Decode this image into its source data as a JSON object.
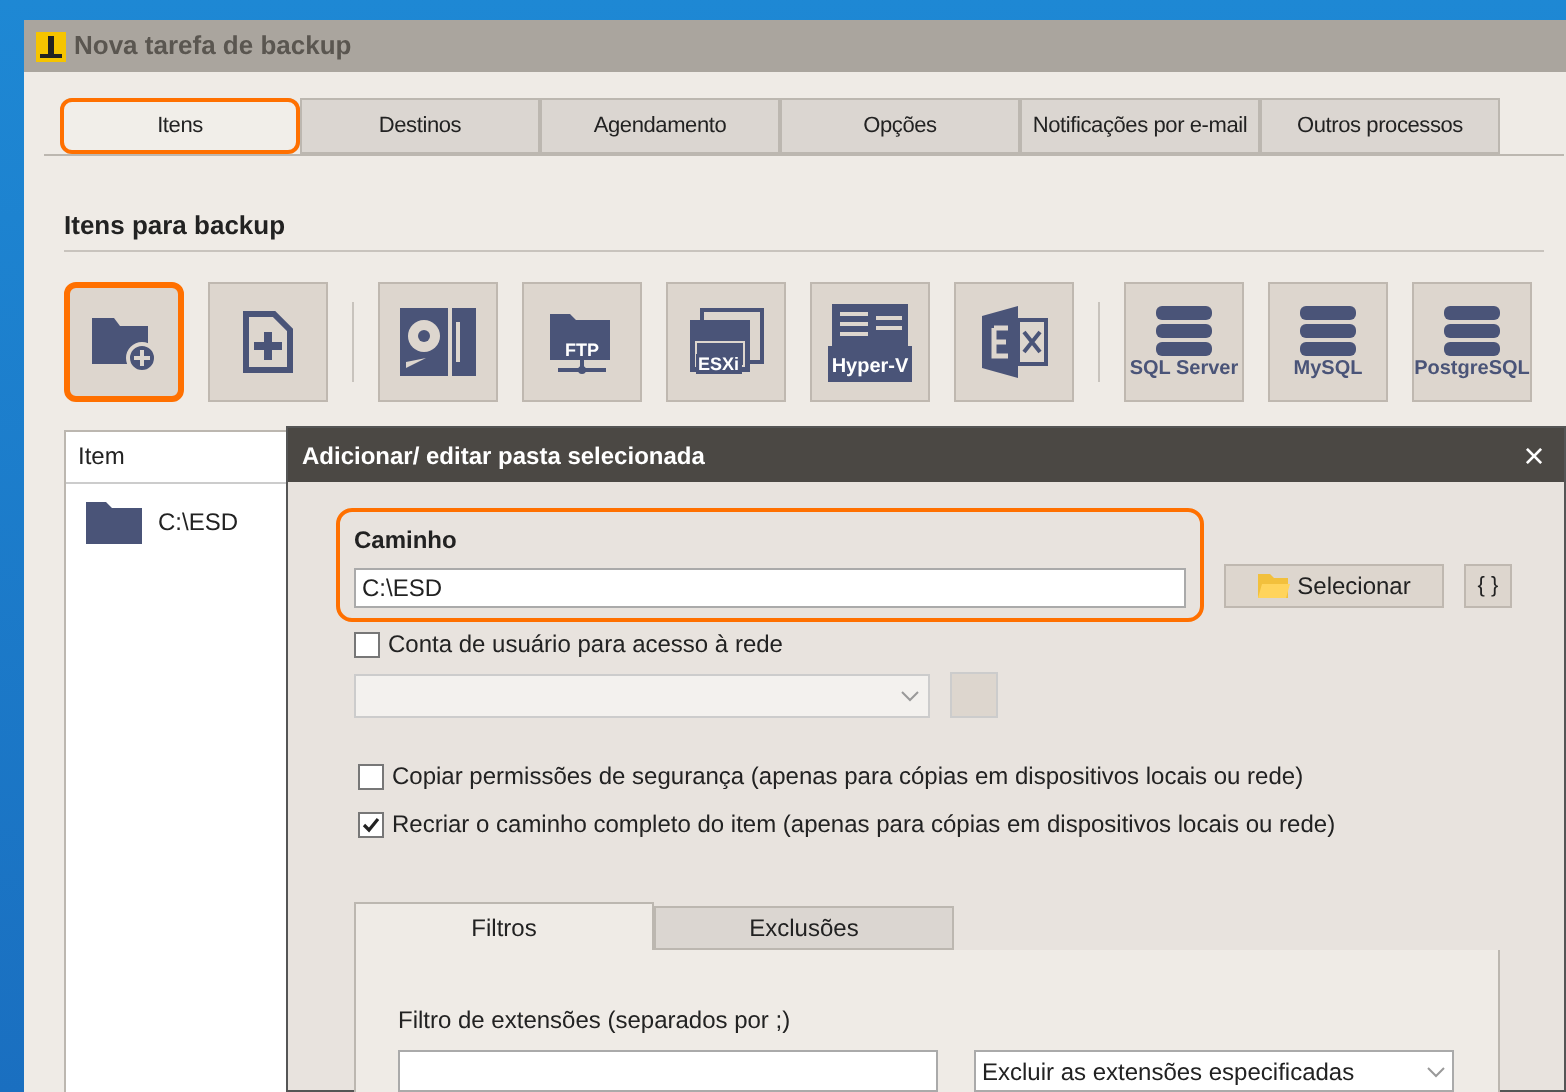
{
  "window": {
    "title": "Nova tarefa de backup"
  },
  "tabs": [
    {
      "label": "Itens",
      "selected": true,
      "highlighted": true
    },
    {
      "label": "Destinos",
      "selected": false,
      "highlighted": false
    },
    {
      "label": "Agendamento",
      "selected": false,
      "highlighted": false
    },
    {
      "label": "Opções",
      "selected": false,
      "highlighted": false
    },
    {
      "label": "Notificações por e-mail",
      "selected": false,
      "highlighted": false
    },
    {
      "label": "Outros processos",
      "selected": false,
      "highlighted": false
    }
  ],
  "section_title": "Itens para backup",
  "toolbar": [
    [
      {
        "kind": "folder-add",
        "highlighted": true
      },
      {
        "kind": "file-add",
        "highlighted": false
      }
    ],
    [
      {
        "kind": "disk",
        "highlighted": false
      },
      {
        "kind": "ftp",
        "label": "FTP",
        "highlighted": false
      },
      {
        "kind": "esxi",
        "label": "ESXi",
        "highlighted": false
      },
      {
        "kind": "hyperv",
        "label": "Hyper-V",
        "highlighted": false
      },
      {
        "kind": "exchange",
        "highlighted": false
      }
    ],
    [
      {
        "kind": "database",
        "label": "SQL Server",
        "highlighted": false
      },
      {
        "kind": "database",
        "label": "MySQL",
        "highlighted": false
      },
      {
        "kind": "database",
        "label": "PostgreSQL",
        "highlighted": false
      }
    ]
  ],
  "item_list": {
    "column": "Item",
    "rows": [
      {
        "name": "C:\\ESD"
      }
    ]
  },
  "dialog": {
    "title": "Adicionar/ editar pasta selecionada",
    "close": "×",
    "path": {
      "label": "Caminho",
      "value": "C:\\ESD",
      "highlighted": true
    },
    "select_button": "Selecionar",
    "vars_button": "{ }",
    "network_account": {
      "label": "Conta de usuário para acesso à rede",
      "checked": false
    },
    "options": [
      {
        "label": "Copiar permissões de segurança (apenas para cópias em dispositivos locais ou rede)",
        "checked": false
      },
      {
        "label": "Recriar o caminho completo do item (apenas para cópias em dispositivos locais ou rede)",
        "checked": true
      }
    ],
    "tabs": [
      {
        "label": "Filtros",
        "selected": true
      },
      {
        "label": "Exclusões",
        "selected": false
      }
    ],
    "filter_label": "Filtro de extensões (separados por ;)",
    "filter_mode": "Excluir as extensões especificadas"
  }
}
